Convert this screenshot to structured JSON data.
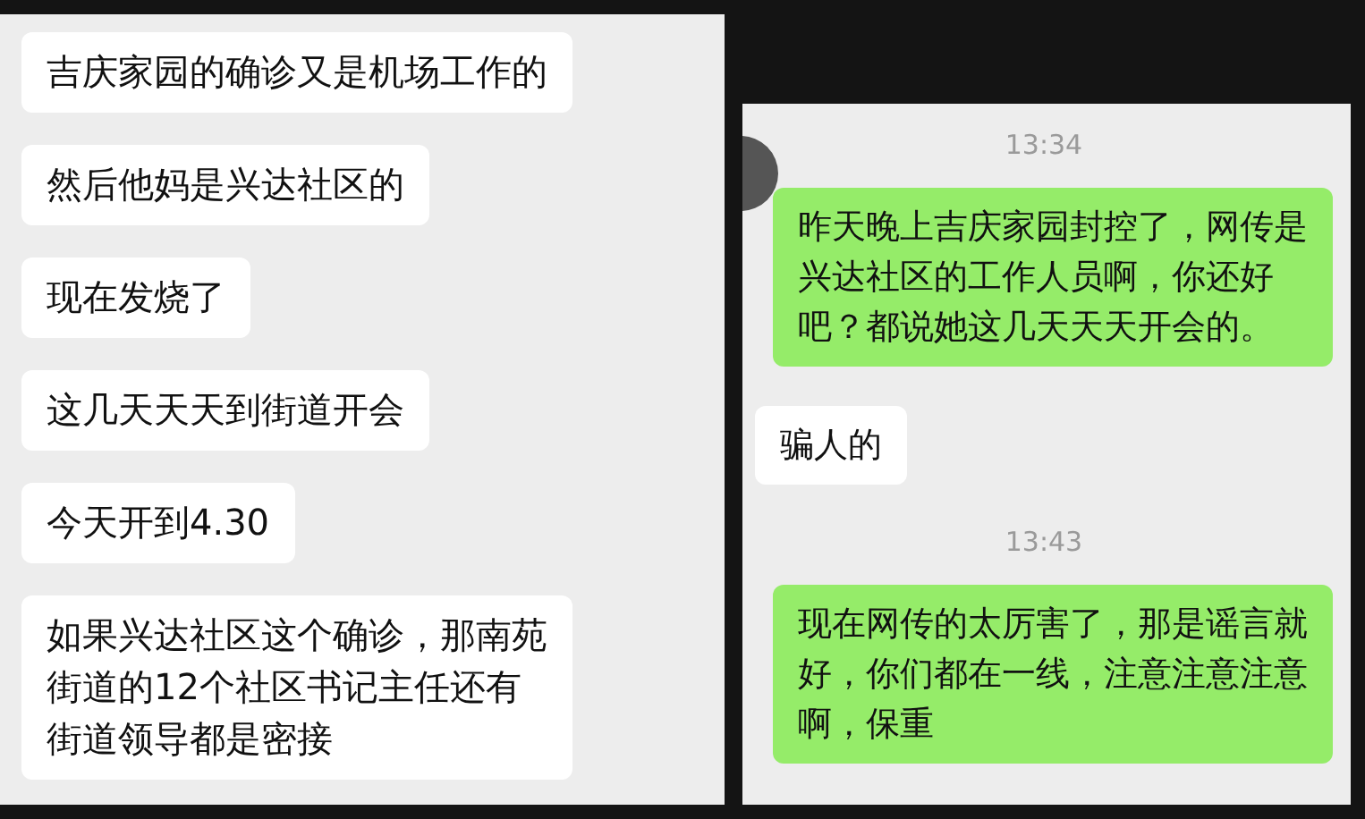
{
  "left_chat": {
    "messages": [
      {
        "outgoing": false,
        "text": "吉庆家园的确诊又是机场工作的"
      },
      {
        "outgoing": false,
        "text": "然后他妈是兴达社区的"
      },
      {
        "outgoing": false,
        "text": "现在发烧了"
      },
      {
        "outgoing": false,
        "text": "这几天天天到街道开会"
      },
      {
        "outgoing": false,
        "text": "今天开到4.30"
      },
      {
        "outgoing": false,
        "text": "如果兴达社区这个确诊，那南苑街道的12个社区书记主任还有街道领导都是密接"
      }
    ]
  },
  "right_chat": {
    "items": [
      {
        "kind": "time",
        "text": "13:34"
      },
      {
        "kind": "message",
        "outgoing": true,
        "text": "昨天晚上吉庆家园封控了，网传是兴达社区的工作人员啊，你还好吧？都说她这几天天天开会的。"
      },
      {
        "kind": "message",
        "outgoing": false,
        "text": "骗人的"
      },
      {
        "kind": "time",
        "text": "13:43"
      },
      {
        "kind": "message",
        "outgoing": true,
        "text": "现在网传的太厉害了，那是谣言就好，你们都在一线，注意注意注意啊，保重"
      }
    ]
  }
}
